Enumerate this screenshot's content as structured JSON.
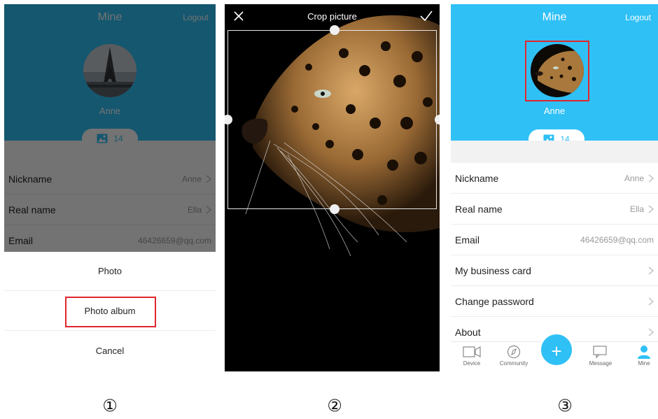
{
  "step_markers": [
    "①",
    "②",
    "③"
  ],
  "profile": {
    "title": "Mine",
    "logout_label": "Logout",
    "name": "Anne",
    "photo_count": "14"
  },
  "fields": [
    {
      "label": "Nickname",
      "value": "Anne"
    },
    {
      "label": "Real name",
      "value": "Ella"
    },
    {
      "label": "Email",
      "value": "46426659@qq.com"
    }
  ],
  "more_fields": [
    {
      "label": "My business card"
    },
    {
      "label": "Change password"
    },
    {
      "label": "About"
    }
  ],
  "action_sheet": {
    "items": [
      "Photo",
      "Photo album",
      "Cancel"
    ]
  },
  "crop": {
    "title": "Crop picture"
  },
  "bottom_nav": {
    "items": [
      "Device",
      "Community",
      "Message",
      "Mine"
    ],
    "fab_symbol": "+"
  },
  "colors": {
    "accent": "#2fc0f6",
    "highlight": "#e0272c"
  },
  "icons": [
    "close-icon",
    "check-icon",
    "image-icon",
    "chevron-right-icon",
    "camera-icon",
    "compass-icon",
    "message-icon",
    "person-icon",
    "plus-icon"
  ]
}
